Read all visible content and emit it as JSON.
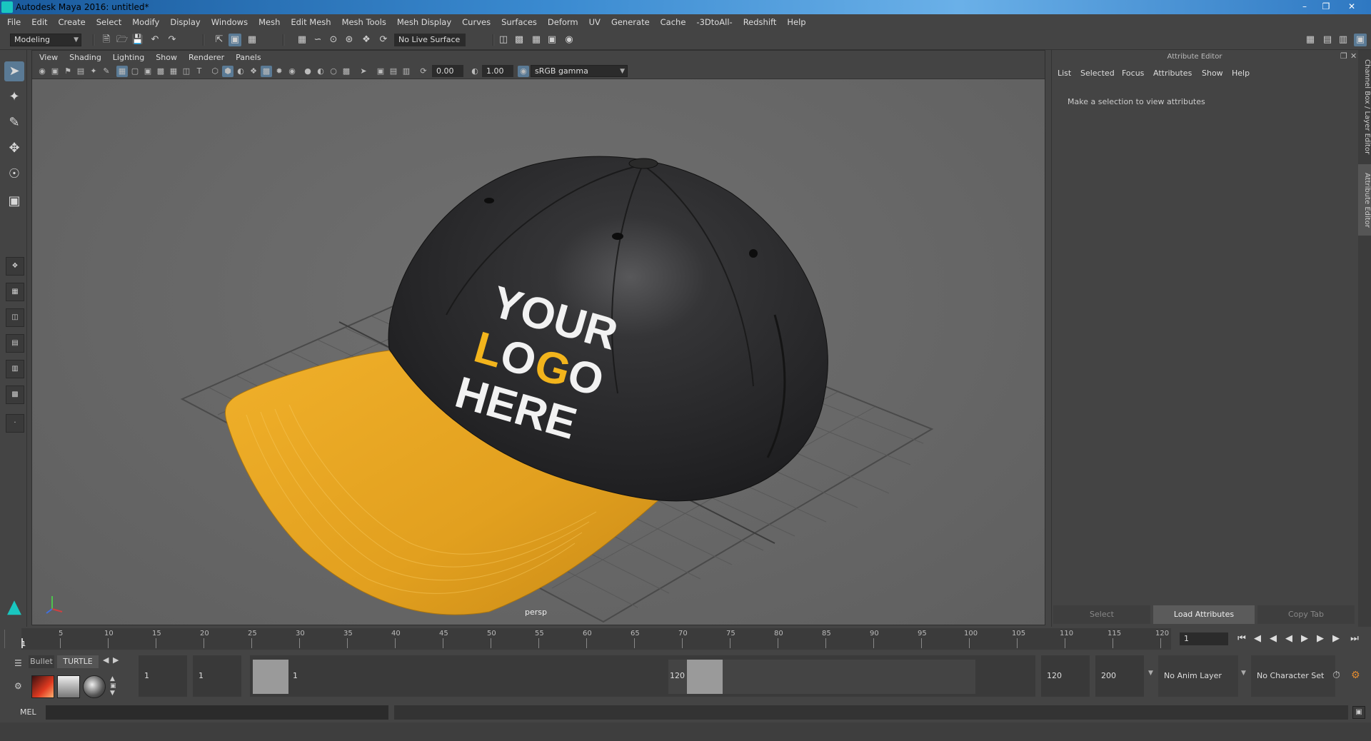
{
  "window": {
    "title": "Autodesk Maya 2016: untitled*"
  },
  "menu": [
    "File",
    "Edit",
    "Create",
    "Select",
    "Modify",
    "Display",
    "Windows",
    "Mesh",
    "Edit Mesh",
    "Mesh Tools",
    "Mesh Display",
    "Curves",
    "Surfaces",
    "Deform",
    "UV",
    "Generate",
    "Cache",
    "-3DtoAll-",
    "Redshift",
    "Help"
  ],
  "status": {
    "mode": "Modeling",
    "live_surface": "No Live Surface"
  },
  "viewport": {
    "menu": [
      "View",
      "Shading",
      "Lighting",
      "Show",
      "Renderer",
      "Panels"
    ],
    "exposure": "0.00",
    "gamma": "1.00",
    "colorspace": "sRGB gamma",
    "camera": "persp"
  },
  "cap": {
    "logo_line1": "YOUR",
    "logo_l": "L",
    "logo_o1": "O",
    "logo_g": "G",
    "logo_o2": "O",
    "logo_line3": "HERE",
    "crown_color": "#2b2b2d",
    "brim_color": "#e6a321",
    "accent_color": "#f2b41c"
  },
  "attribute_editor": {
    "title": "Attribute Editor",
    "menu": [
      "List",
      "Selected",
      "Focus",
      "Attributes",
      "Show",
      "Help"
    ],
    "hint": "Make a selection to view attributes",
    "buttons": {
      "select": "Select",
      "load": "Load Attributes",
      "copy": "Copy Tab"
    },
    "side_tabs": [
      "Channel Box / Layer Editor",
      "Attribute Editor"
    ]
  },
  "timeline": {
    "ticks": [
      "5",
      "10",
      "15",
      "20",
      "25",
      "30",
      "35",
      "40",
      "45",
      "50",
      "55",
      "60",
      "65",
      "70",
      "75",
      "80",
      "85",
      "90",
      "95",
      "100",
      "105",
      "110",
      "115",
      "120"
    ],
    "start_marker": "1",
    "current_frame": "1"
  },
  "range": {
    "start": "1",
    "playback_start": "1",
    "range_start_label": "1",
    "range_end_label": "120",
    "playback_end": "120",
    "end": "200",
    "anim_layer": "No Anim Layer",
    "character_set": "No Character Set"
  },
  "shelf": {
    "tab1": "Bullet",
    "tab2": "TURTLE"
  },
  "command": {
    "label": "MEL"
  }
}
